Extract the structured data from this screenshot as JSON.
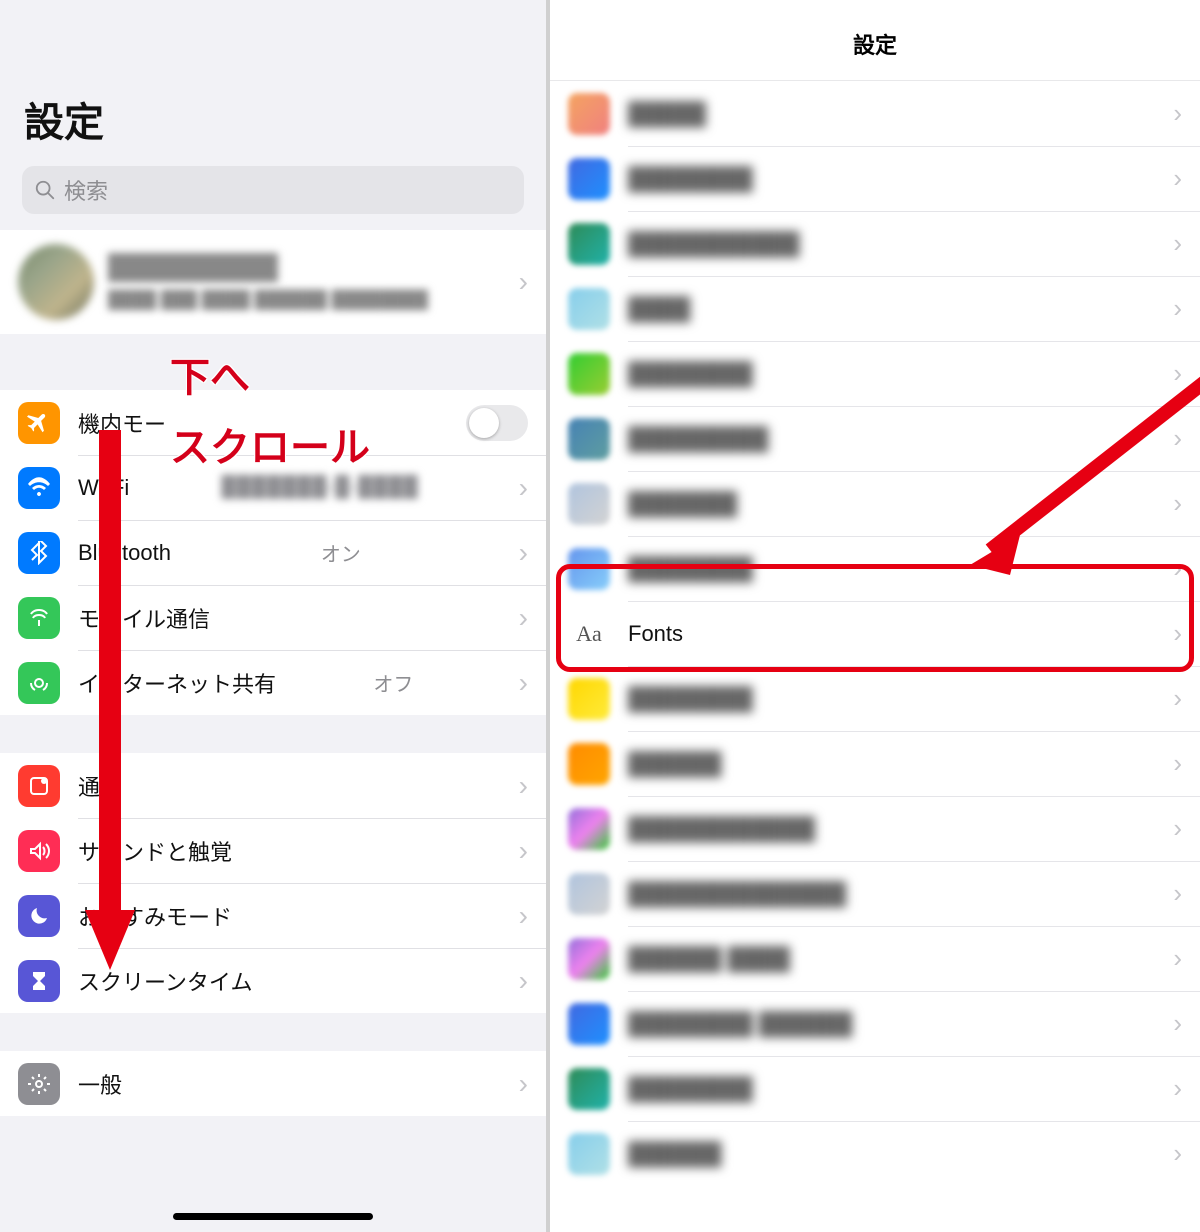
{
  "left": {
    "title": "設定",
    "search_placeholder": "検索",
    "annotation_line1": "下へ",
    "annotation_line2": "スクロール",
    "rows": {
      "airplane": "機内モー",
      "wifi": "Wi-Fi",
      "bluetooth": "Bluetooth",
      "bluetooth_value": "オン",
      "cellular": "モバイル通信",
      "hotspot": "インターネット共有",
      "hotspot_value": "オフ",
      "notifications": "通知",
      "sounds": "サウンドと触覚",
      "dnd": "おやすみモード",
      "screentime": "スクリーンタイム",
      "general": "一般"
    }
  },
  "right": {
    "title": "設定",
    "fonts_label": "Fonts"
  }
}
